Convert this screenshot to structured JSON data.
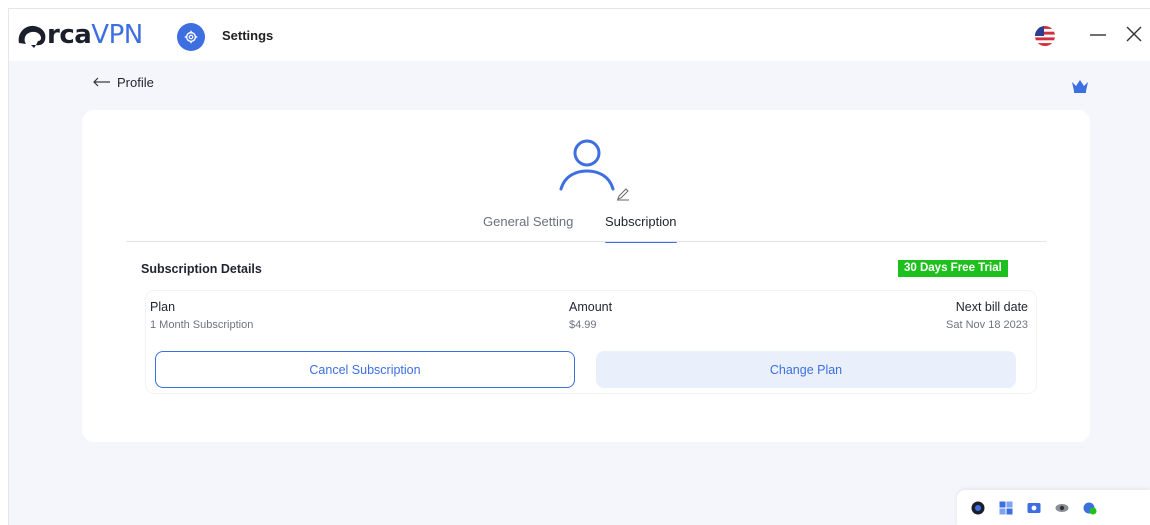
{
  "app": {
    "brand_prefix": "rca",
    "brand_suffix": "VPN",
    "window_title": "Settings",
    "brand_color": "#3d6fe0"
  },
  "nav": {
    "back_label": "Profile"
  },
  "tabs": [
    {
      "label": "General Setting",
      "active": false
    },
    {
      "label": "Subscription",
      "active": true
    }
  ],
  "subscription": {
    "header": "Subscription Details",
    "badge": "30 Days Free Trial",
    "badge_color": "#1ec01e",
    "plan_label": "Plan",
    "plan_value": "1 Month Subscription",
    "amount_label": "Amount",
    "amount_value": "$4.99",
    "next_bill_label": "Next bill date",
    "next_bill_value": "Sat Nov 18 2023",
    "cancel_label": "Cancel Subscription",
    "change_label": "Change Plan"
  },
  "icons": {
    "logo": "orca-logo-icon",
    "settings": "gear-icon",
    "flag": "us-flag-icon",
    "minimize": "minimize-icon",
    "close": "close-icon",
    "back": "arrow-left-icon",
    "premium": "crown-icon",
    "avatar": "user-avatar-icon",
    "edit": "pencil-icon"
  }
}
